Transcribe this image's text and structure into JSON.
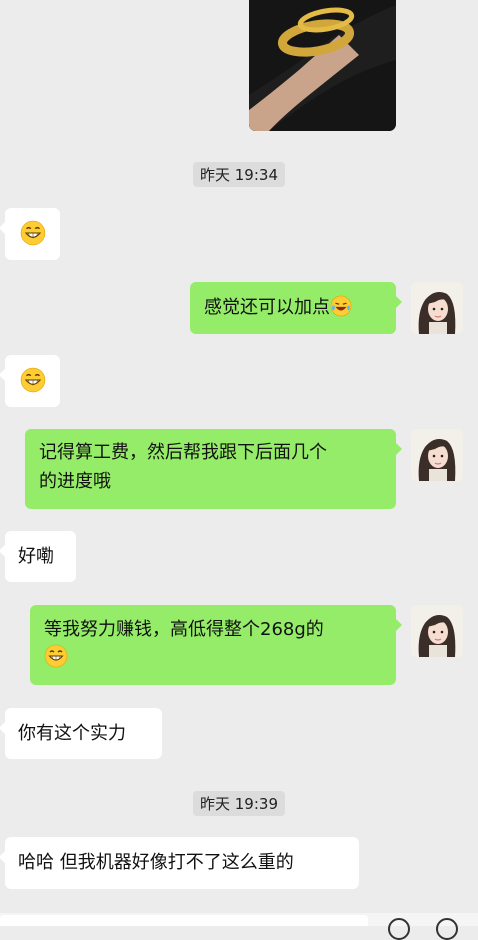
{
  "chat": {
    "timestamps": [
      "昨天 19:34",
      "昨天 19:39"
    ],
    "messages": [
      {
        "side": "in",
        "text": "",
        "emoji": "grinning-face-icon"
      },
      {
        "side": "out",
        "text": "感觉还可以加点",
        "emoji": "laughing-tears-icon"
      },
      {
        "side": "in",
        "text": "",
        "emoji": "grinning-face-icon"
      },
      {
        "side": "out",
        "lines": [
          "记得算工费，然后帮我跟下后面几个",
          "的进度哦"
        ]
      },
      {
        "side": "in",
        "text": "好嘞"
      },
      {
        "side": "out",
        "lines": [
          "等我努力赚钱，高低得整个268g的"
        ],
        "emoji": "grinning-face-icon"
      },
      {
        "side": "in",
        "text": "你有这个实力"
      },
      {
        "side": "in",
        "text": "哈哈 但我机器好像打不了这么重的"
      }
    ]
  },
  "colors": {
    "background": "#ececec",
    "incoming_bubble": "#ffffff",
    "outgoing_bubble": "#95ec69",
    "timestamp_bg": "#dcdcdc"
  }
}
